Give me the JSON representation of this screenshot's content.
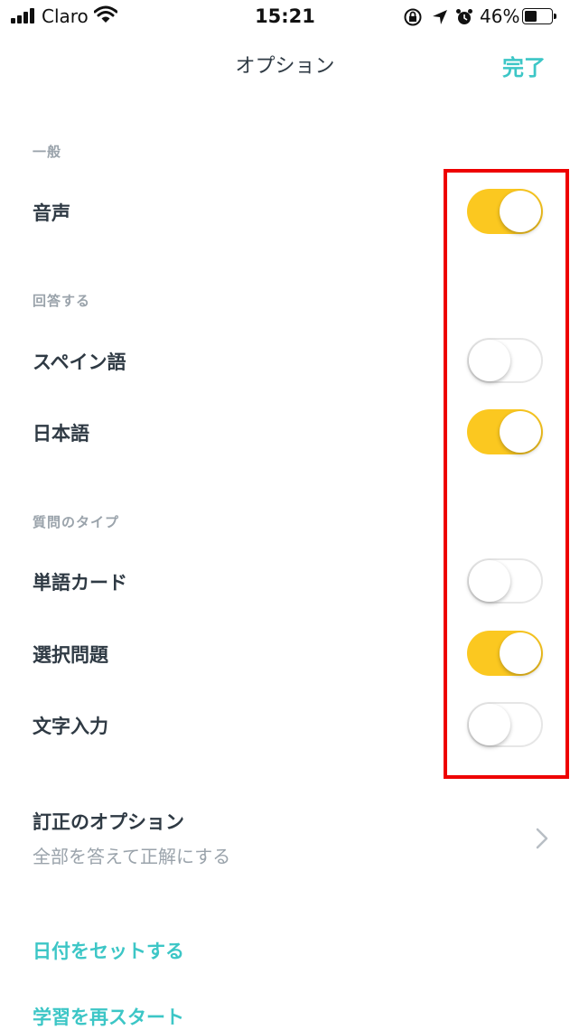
{
  "status_bar": {
    "carrier": "Claro",
    "time": "15:21",
    "battery_percent": "46%",
    "battery_level": 0.46,
    "icons": [
      "signal-icon",
      "wifi-icon",
      "orientation-lock-icon",
      "location-icon",
      "alarm-icon",
      "battery-icon"
    ]
  },
  "nav": {
    "title": "オプション",
    "done": "完了"
  },
  "sections": {
    "general": {
      "header": "一般",
      "items": [
        {
          "label": "音声",
          "on": true
        }
      ]
    },
    "answer": {
      "header": "回答する",
      "items": [
        {
          "label": "スペイン語",
          "on": false
        },
        {
          "label": "日本語",
          "on": true
        }
      ]
    },
    "question_types": {
      "header": "質問のタイプ",
      "items": [
        {
          "label": "単語カード",
          "on": false
        },
        {
          "label": "選択問題",
          "on": true
        },
        {
          "label": "文字入力",
          "on": false
        }
      ]
    }
  },
  "correction": {
    "title": "訂正のオプション",
    "subtitle": "全部を答えて正解にする"
  },
  "links": {
    "set_date": "日付をセットする",
    "restart": "学習を再スタート"
  },
  "colors": {
    "accent": "#3cc6c6",
    "toggle_on": "#fbc820",
    "highlight": "#ee0000"
  }
}
